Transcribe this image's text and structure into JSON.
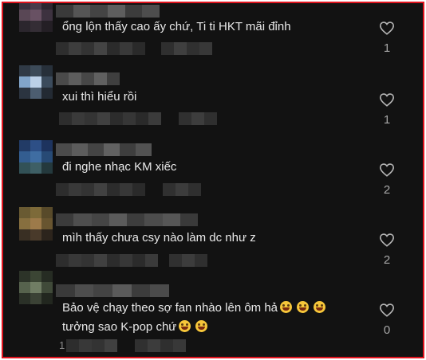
{
  "comments": [
    {
      "text": "ổng lộn thấy cao ấy chứ, Ti ti HKT mãi đỉnh",
      "likes": "1",
      "meta_prefix": ""
    },
    {
      "text": "xui thì hiểu rồi",
      "likes": "1",
      "meta_prefix": ""
    },
    {
      "text": "đi nghe nhạc KM xiếc",
      "likes": "2",
      "meta_prefix": ""
    },
    {
      "text": "mìh thấy chưa csy nào làm dc như z",
      "likes": "2",
      "meta_prefix": ""
    },
    {
      "text_line1": "Bảo vệ chạy theo sợ fan nhào lên ôm hả",
      "text_line2": "tưởng sao K-pop chứ",
      "likes": "0",
      "meta_prefix": "1"
    }
  ],
  "icons": {
    "like": "heart-outline-icon",
    "emoji": "laughing-tears-emoji"
  },
  "colors": {
    "background": "#121212",
    "border": "#e0141e",
    "text": "#e9e9e9",
    "muted": "#a8a8a8"
  }
}
